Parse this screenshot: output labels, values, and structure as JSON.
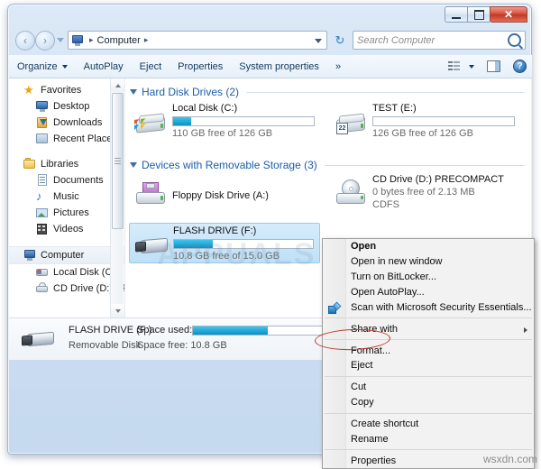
{
  "window": {
    "controls": {
      "minimize": "Minimize",
      "maximize": "Maximize",
      "close": "✕"
    }
  },
  "addressbar": {
    "back": "‹",
    "forward": "›",
    "crumb_root": "Computer",
    "sep": "▸",
    "refresh": "↻",
    "search_placeholder": "Search Computer"
  },
  "toolbar": {
    "items": [
      {
        "label": "Organize",
        "caret": true
      },
      {
        "label": "AutoPlay",
        "caret": false
      },
      {
        "label": "Eject",
        "caret": false
      },
      {
        "label": "Properties",
        "caret": false
      },
      {
        "label": "System properties",
        "caret": false
      },
      {
        "label": "»",
        "caret": false
      }
    ],
    "help_label": "?"
  },
  "sidebar": {
    "groups": [
      {
        "header": "Favorites",
        "icon": "star-icon",
        "items": [
          {
            "label": "Desktop",
            "icon": "desktop-icon"
          },
          {
            "label": "Downloads",
            "icon": "downloads-icon"
          },
          {
            "label": "Recent Places",
            "icon": "recent-places-icon"
          }
        ]
      },
      {
        "header": "Libraries",
        "icon": "libraries-icon",
        "items": [
          {
            "label": "Documents",
            "icon": "documents-icon"
          },
          {
            "label": "Music",
            "icon": "music-icon"
          },
          {
            "label": "Pictures",
            "icon": "pictures-icon"
          },
          {
            "label": "Videos",
            "icon": "videos-icon"
          }
        ]
      },
      {
        "header": "Computer",
        "icon": "computer-icon",
        "selected": true,
        "items": [
          {
            "label": "Local Disk (C:)",
            "icon": "hard-disk-icon"
          },
          {
            "label": "CD Drive (D:) PRE",
            "icon": "cd-drive-icon"
          }
        ]
      }
    ]
  },
  "content": {
    "groups": [
      {
        "title": "Hard Disk Drives (2)",
        "drives": [
          {
            "name": "Local Disk (C:)",
            "free_text": "110 GB free of 126 GB",
            "used_percent": 13,
            "icon": "hard-disk-windows-icon",
            "selected": false
          },
          {
            "name": "TEST (E:)",
            "free_text": "126 GB free of 126 GB",
            "used_percent": 0,
            "icon": "hard-disk-icon",
            "selected": false
          }
        ]
      },
      {
        "title": "Devices with Removable Storage (3)",
        "drives": [
          {
            "name": "Floppy Disk Drive (A:)",
            "free_text": "",
            "used_percent": null,
            "icon": "floppy-disk-icon",
            "selected": false
          },
          {
            "name": "CD Drive (D:) PRECOMPACT",
            "free_text": "0 bytes free of 2.13 MB",
            "subtext": "CDFS",
            "used_percent": null,
            "icon": "cd-drive-icon",
            "selected": false
          },
          {
            "name": "FLASH DRIVE (F:)",
            "free_text": "10.8 GB free of 15.0 GB",
            "used_percent": 28,
            "icon": "usb-flash-drive-icon",
            "selected": true
          }
        ]
      }
    ]
  },
  "details_pane": {
    "title": "FLASH DRIVE (F:)",
    "type": "Removable Disk",
    "space_used_label": "Space used:",
    "space_used_percent": 28,
    "space_free_label": "Space free: 10.8 GB",
    "icon": "usb-flash-drive-icon"
  },
  "context_menu": {
    "items": [
      {
        "label": "Open",
        "bold": true,
        "sep_after": false,
        "icon": null,
        "submenu": false
      },
      {
        "label": "Open in new window",
        "bold": false,
        "sep_after": false,
        "icon": null,
        "submenu": false
      },
      {
        "label": "Turn on BitLocker...",
        "bold": false,
        "sep_after": false,
        "icon": null,
        "submenu": false
      },
      {
        "label": "Open AutoPlay...",
        "bold": false,
        "sep_after": false,
        "icon": null,
        "submenu": false
      },
      {
        "label": "Scan with Microsoft Security Essentials...",
        "bold": false,
        "sep_after": true,
        "icon": "shield-icon",
        "submenu": false
      },
      {
        "label": "Share with",
        "bold": false,
        "sep_after": true,
        "icon": null,
        "submenu": true
      },
      {
        "label": "Format...",
        "bold": false,
        "sep_after": false,
        "icon": null,
        "submenu": false,
        "highlighted": true
      },
      {
        "label": "Eject",
        "bold": false,
        "sep_after": true,
        "icon": null,
        "submenu": false
      },
      {
        "label": "Cut",
        "bold": false,
        "sep_after": false,
        "icon": null,
        "submenu": false
      },
      {
        "label": "Copy",
        "bold": false,
        "sep_after": true,
        "icon": null,
        "submenu": false
      },
      {
        "label": "Create shortcut",
        "bold": false,
        "sep_after": false,
        "icon": null,
        "submenu": false
      },
      {
        "label": "Rename",
        "bold": false,
        "sep_after": true,
        "icon": null,
        "submenu": false
      },
      {
        "label": "Properties",
        "bold": false,
        "sep_after": false,
        "icon": null,
        "submenu": false
      }
    ]
  },
  "annotations": {
    "highlight_target": "Format...",
    "highlight_color": "#c0392b"
  },
  "watermarks": {
    "center": "APPUALS",
    "corner": "wsxdn.com"
  }
}
